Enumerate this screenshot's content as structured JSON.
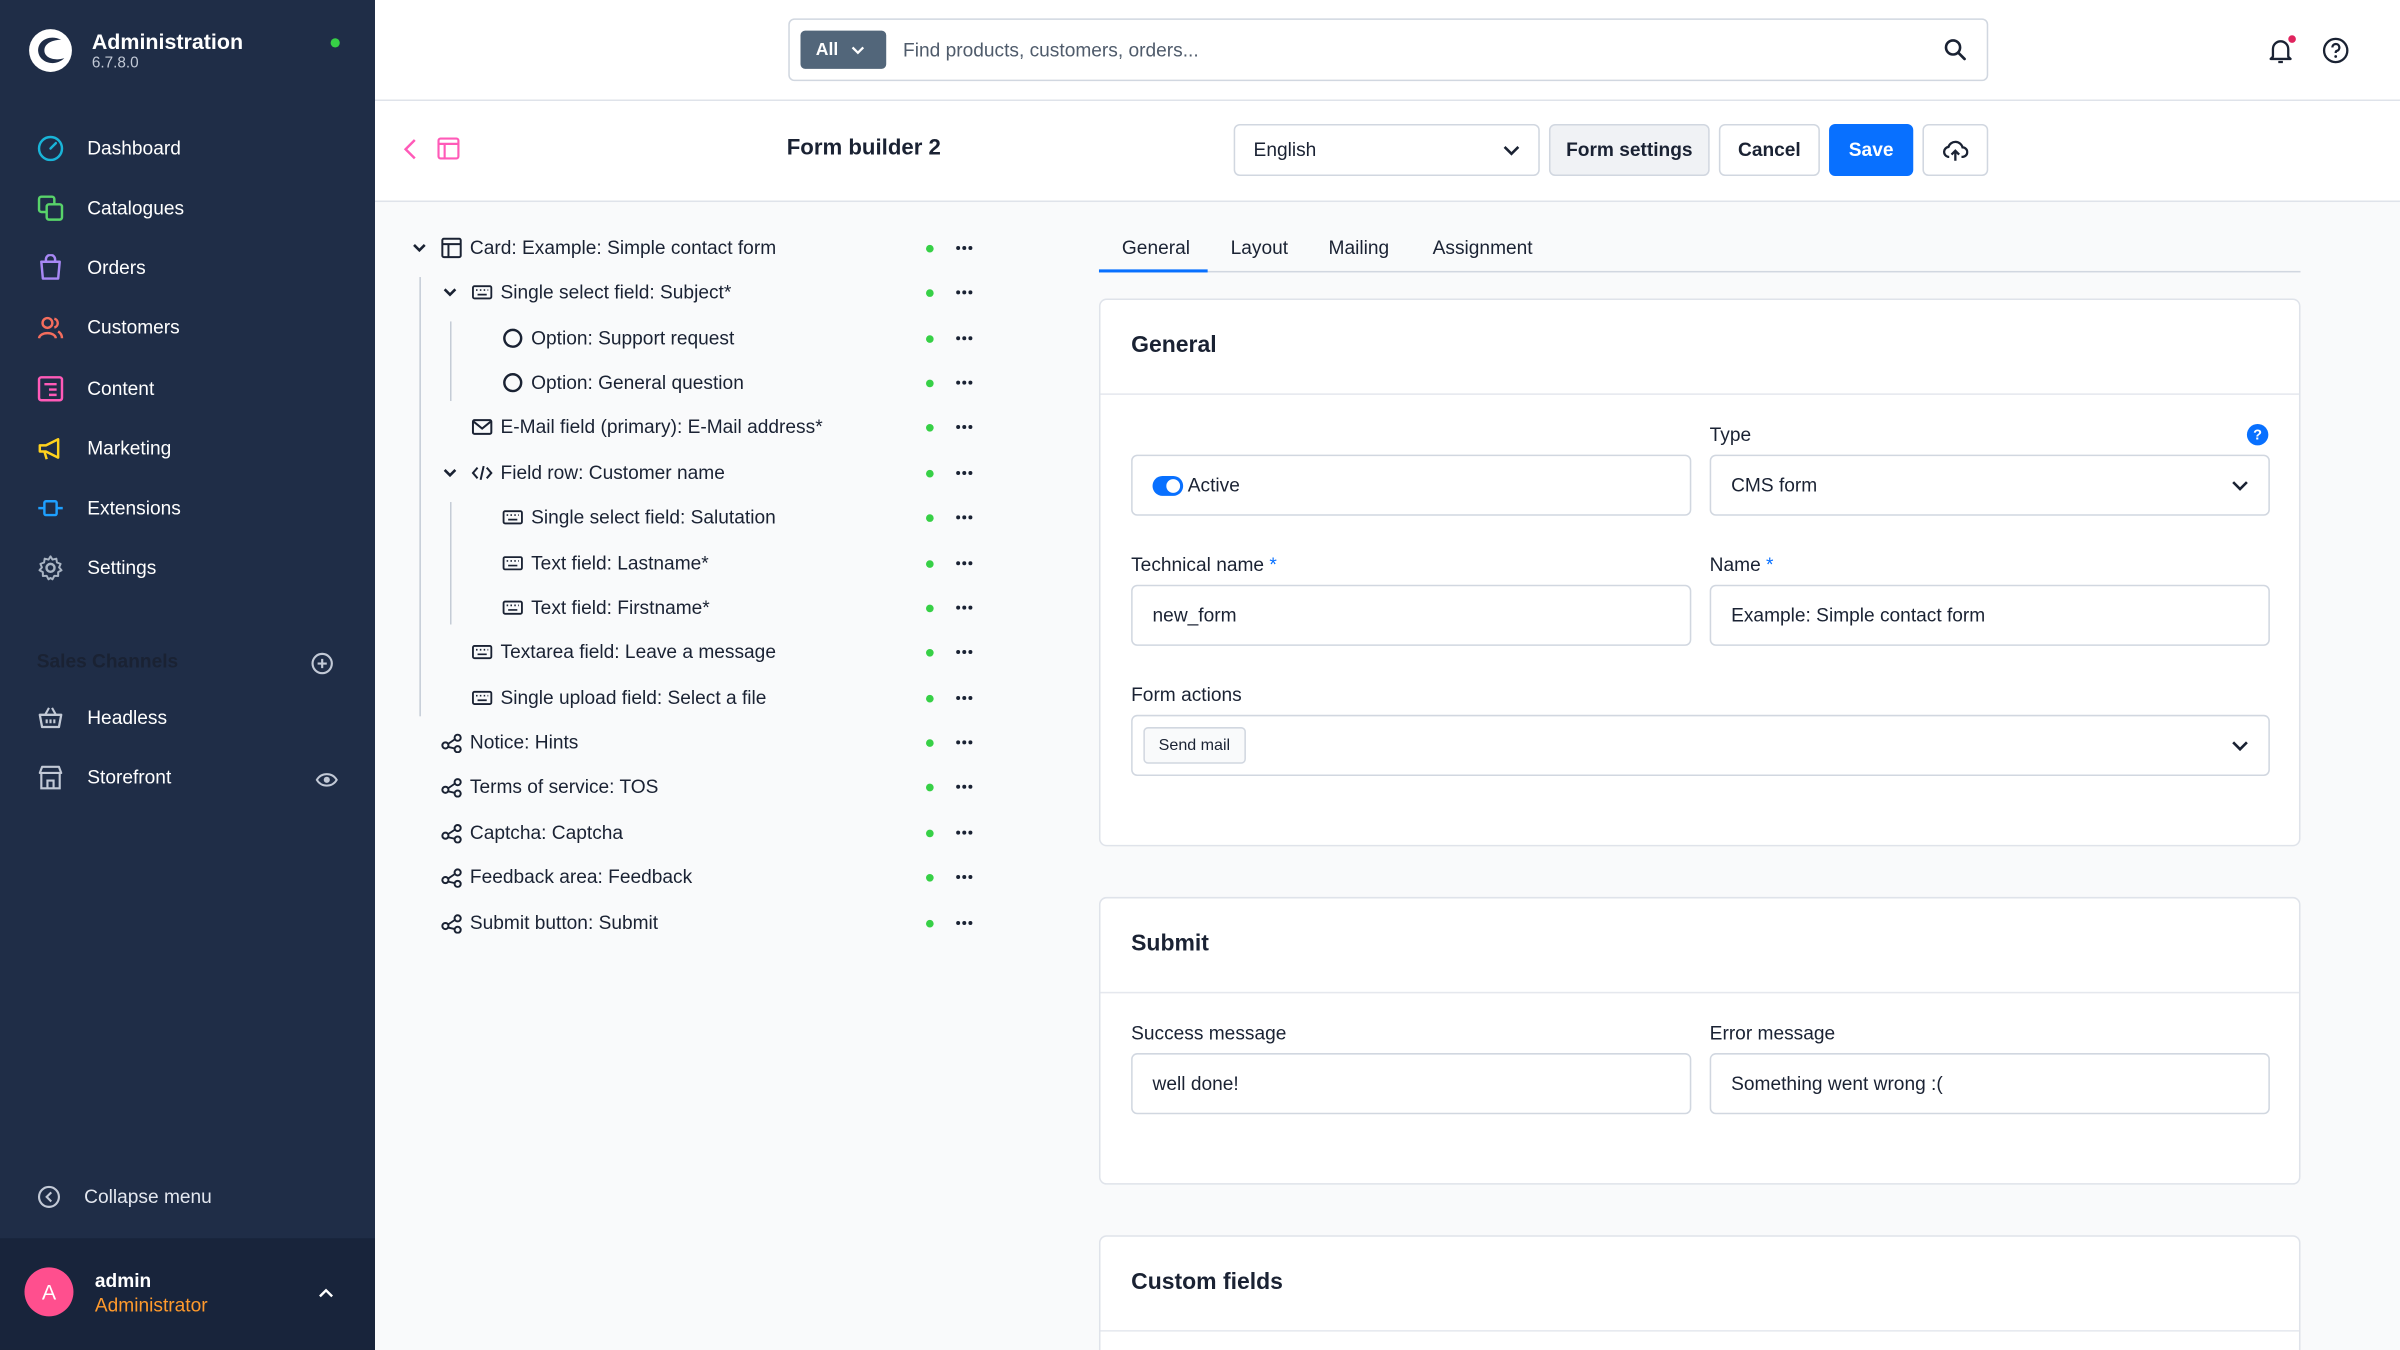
{
  "app": {
    "title": "Administration",
    "version": "6.7.8.0"
  },
  "nav": [
    {
      "label": "Dashboard",
      "icon": "dashboard-icon",
      "color": "#19b4d8"
    },
    {
      "label": "Catalogues",
      "icon": "catalogue-icon",
      "color": "#58d36a"
    },
    {
      "label": "Orders",
      "icon": "orders-icon",
      "color": "#a888f5"
    },
    {
      "label": "Customers",
      "icon": "customers-icon",
      "color": "#f46d5d"
    },
    {
      "label": "Content",
      "icon": "content-icon",
      "color": "#ff5ab8"
    },
    {
      "label": "Marketing",
      "icon": "marketing-icon",
      "color": "#ffd21d"
    },
    {
      "label": "Extensions",
      "icon": "extensions-icon",
      "color": "#1ea0ff"
    },
    {
      "label": "Settings",
      "icon": "settings-icon",
      "color": "#a9b4c3"
    }
  ],
  "sales_channels": {
    "title": "Sales Channels",
    "items": [
      {
        "label": "Headless",
        "icon": "basket-icon"
      },
      {
        "label": "Storefront",
        "icon": "storefront-icon"
      }
    ]
  },
  "collapse_label": "Collapse menu",
  "user": {
    "initial": "A",
    "name": "admin",
    "role": "Administrator"
  },
  "search": {
    "scope": "All",
    "placeholder": "Find products, customers, orders..."
  },
  "page": {
    "title": "Form builder 2",
    "language": "English",
    "form_settings_label": "Form settings",
    "cancel_label": "Cancel",
    "save_label": "Save"
  },
  "tree": [
    {
      "label": "Card: Example: Simple contact form",
      "icon": "card-icon"
    },
    {
      "label": "Single select field: Subject*",
      "icon": "keyboard-icon"
    },
    {
      "label": "Option: Support request",
      "icon": "option-icon"
    },
    {
      "label": "Option: General question",
      "icon": "option-icon"
    },
    {
      "label": "E-Mail field (primary): E-Mail address*",
      "icon": "mail-icon"
    },
    {
      "label": "Field row: Customer name",
      "icon": "code-icon"
    },
    {
      "label": "Single select field: Salutation",
      "icon": "keyboard-icon"
    },
    {
      "label": "Text field: Lastname*",
      "icon": "keyboard-icon"
    },
    {
      "label": "Text field: Firstname*",
      "icon": "keyboard-icon"
    },
    {
      "label": "Textarea field: Leave a message",
      "icon": "keyboard-icon"
    },
    {
      "label": "Single upload field: Select a file",
      "icon": "keyboard-icon"
    },
    {
      "label": "Notice: Hints",
      "icon": "share-icon"
    },
    {
      "label": "Terms of service: TOS",
      "icon": "share-icon"
    },
    {
      "label": "Captcha: Captcha",
      "icon": "share-icon"
    },
    {
      "label": "Feedback area: Feedback",
      "icon": "share-icon"
    },
    {
      "label": "Submit button: Submit",
      "icon": "share-icon"
    }
  ],
  "tabs": [
    "General",
    "Layout",
    "Mailing",
    "Assignment"
  ],
  "general": {
    "title": "General",
    "active_label": "Active",
    "type_label": "Type",
    "type_value": "CMS form",
    "technical_name_label": "Technical name",
    "technical_name_value": "new_form",
    "name_label": "Name",
    "name_value": "Example: Simple contact form",
    "form_actions_label": "Form actions",
    "form_action_chip": "Send mail",
    "help_glyph": "?",
    "required_mark": "*"
  },
  "submit": {
    "title": "Submit",
    "success_label": "Success message",
    "success_value": "well done!",
    "error_label": "Error message",
    "error_value": "Something went wrong :("
  },
  "custom_fields": {
    "title": "Custom fields"
  },
  "colors": {
    "sidebar": "#1f2d47",
    "primary": "#0870ff",
    "status_ok": "#37d046",
    "avatar": "#ff4f8e",
    "role": "#ff9a2c"
  }
}
